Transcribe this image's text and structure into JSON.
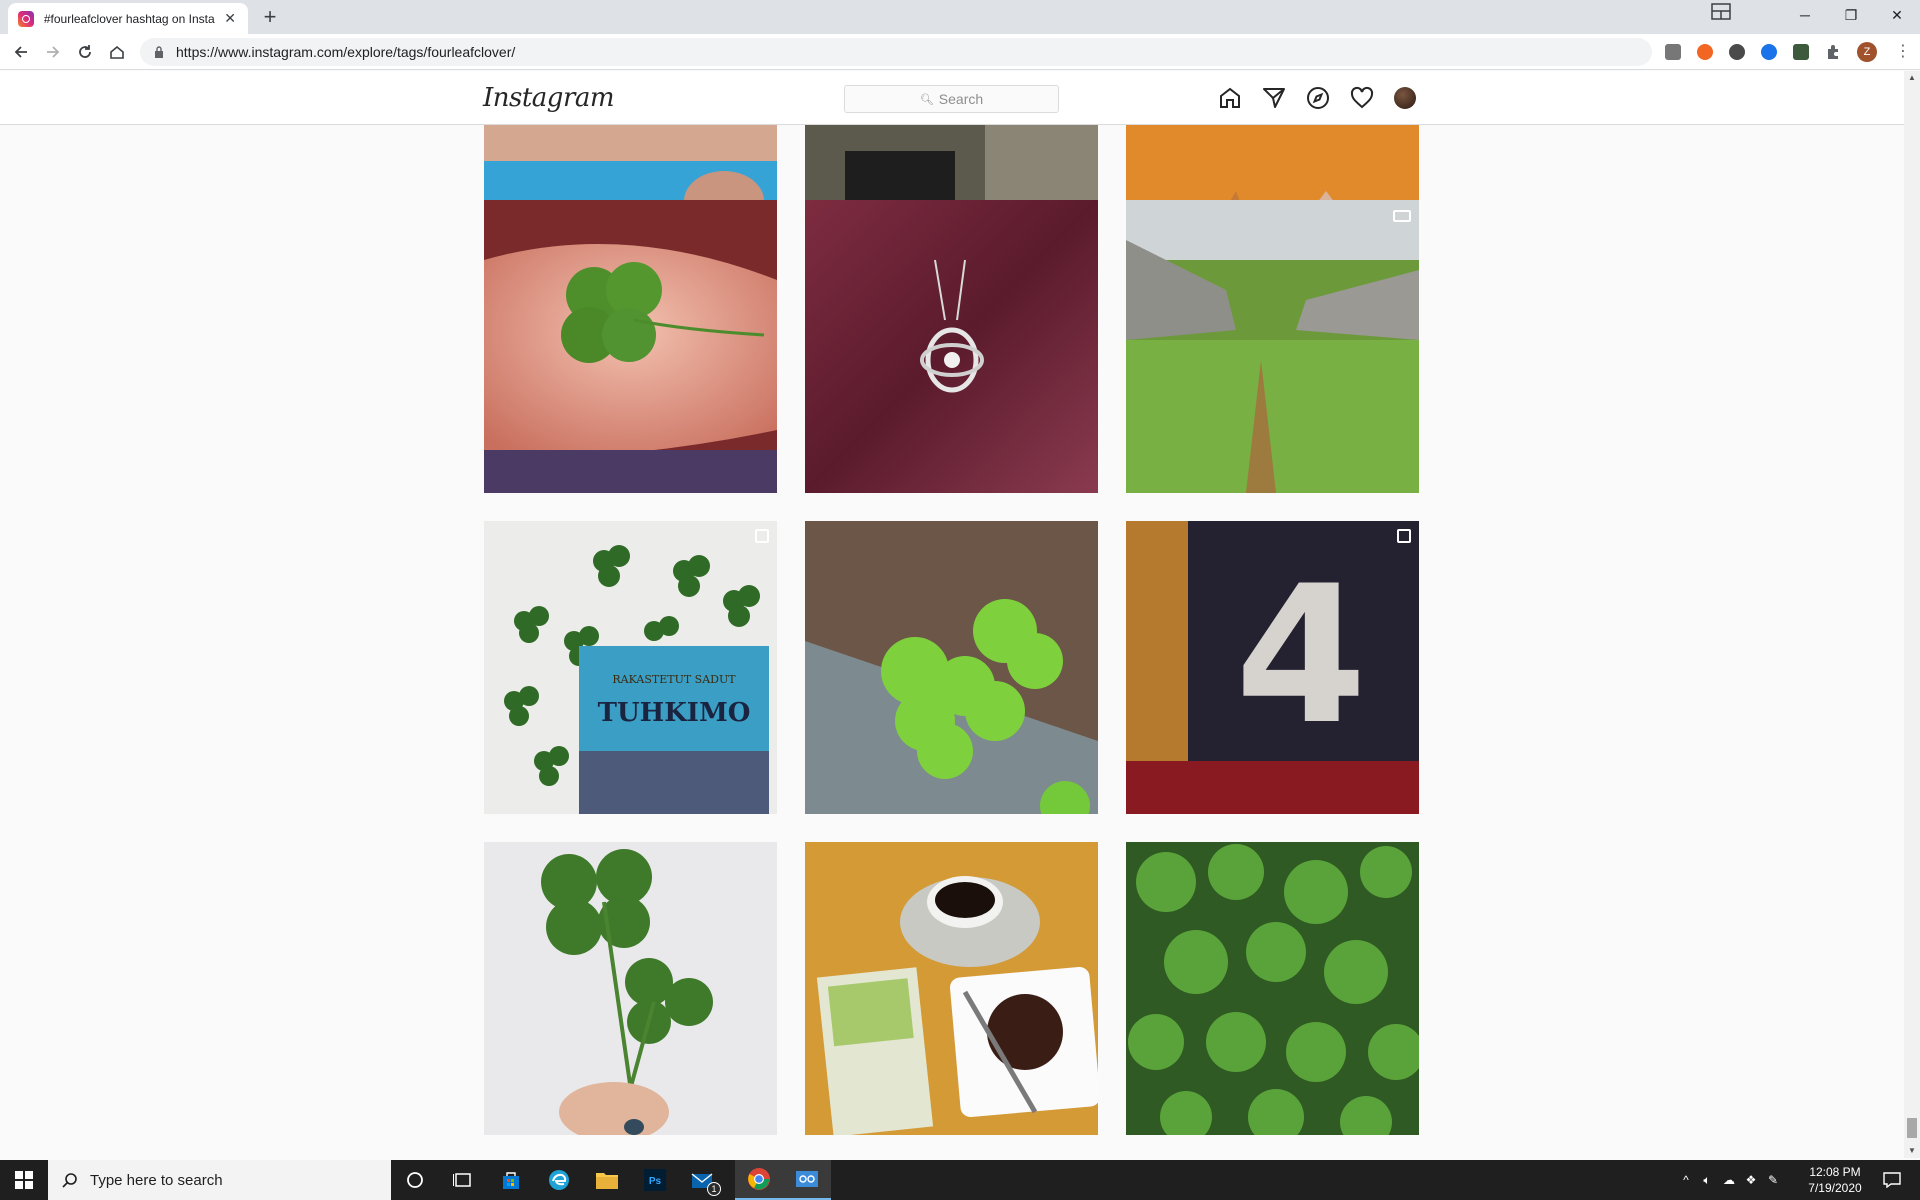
{
  "browser": {
    "tab_title": "#fourleafclover hashtag on Insta",
    "tab_close": "✕",
    "new_tab": "+",
    "url": "https://www.instagram.com/explore/tags/fourleafclover/",
    "profile_initial": "Z",
    "window_controls": {
      "minimize": "─",
      "maximize": "❐",
      "close": "✕"
    }
  },
  "instagram": {
    "logo": "Instagram",
    "search_placeholder": "Search"
  },
  "posts": [
    {
      "row": 0,
      "col": 0,
      "description": "person in blue shirt (cropped)",
      "badge": "none"
    },
    {
      "row": 0,
      "col": 1,
      "description": "hand holding clover near tree (cropped)",
      "badge": "none"
    },
    {
      "row": 0,
      "col": 2,
      "description": "legs on orange background (cropped)",
      "badge": "none"
    },
    {
      "row": 1,
      "col": 0,
      "description": "four-leaf clover in palm",
      "badge": "none"
    },
    {
      "row": 1,
      "col": 1,
      "description": "silver clover pendant on burgundy satin",
      "badge": "none"
    },
    {
      "row": 1,
      "col": 2,
      "description": "grassy path between stone walls",
      "badge": "video"
    },
    {
      "row": 2,
      "col": 0,
      "description": "pressed clovers around a book",
      "badge": "multiple"
    },
    {
      "row": 2,
      "col": 1,
      "description": "bright green clover by wood",
      "badge": "none"
    },
    {
      "row": 2,
      "col": 2,
      "description": "number 4 painted on asphalt",
      "badge": "multiple"
    },
    {
      "row": 3,
      "col": 0,
      "description": "hand holding four-leaf clovers",
      "badge": "none"
    },
    {
      "row": 3,
      "col": 1,
      "description": "coffee, book and cake on table",
      "badge": "none"
    },
    {
      "row": 3,
      "col": 2,
      "description": "clover patch",
      "badge": "none"
    }
  ],
  "post_texts": {
    "book_series": "RAKASTETUT SADUT",
    "book_title": "TUHKIMO"
  },
  "taskbar": {
    "search_placeholder": "Type here to search",
    "time": "12:08 PM",
    "date": "7/19/2020",
    "mail_badge": "1"
  }
}
